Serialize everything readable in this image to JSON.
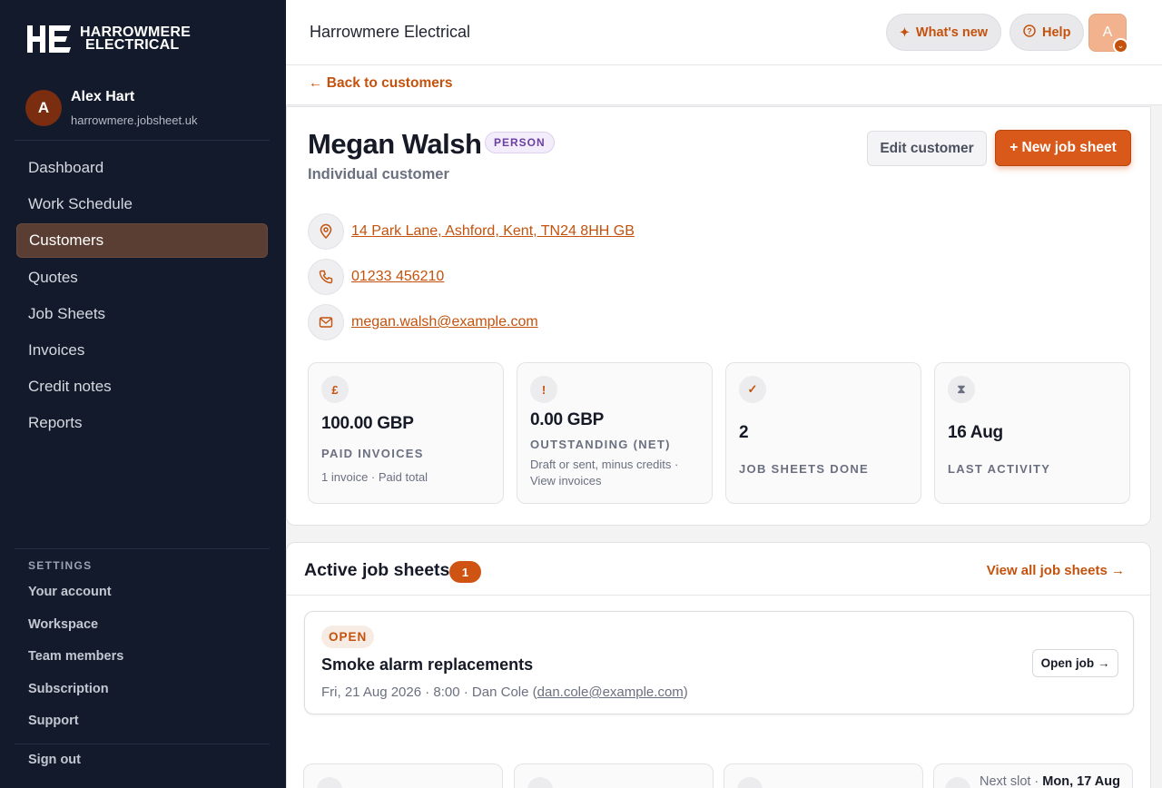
{
  "brand": {
    "name_line1": "HARROWMERE",
    "name_line2": "ELECTRICAL"
  },
  "user": {
    "initial": "A",
    "name": "Alex Hart",
    "domain": "harrowmere.jobsheet.uk"
  },
  "nav": [
    {
      "label": "Dashboard",
      "active": false
    },
    {
      "label": "Work Schedule",
      "active": false
    },
    {
      "label": "Customers",
      "active": true
    },
    {
      "label": "Quotes",
      "active": false
    },
    {
      "label": "Job Sheets",
      "active": false
    },
    {
      "label": "Invoices",
      "active": false
    },
    {
      "label": "Credit notes",
      "active": false
    },
    {
      "label": "Reports",
      "active": false
    }
  ],
  "settings": {
    "heading": "SETTINGS",
    "items": [
      "Your account",
      "Workspace",
      "Team members",
      "Subscription",
      "Support"
    ],
    "sign_out": "Sign out"
  },
  "topbar": {
    "title": "Harrowmere Electrical",
    "whats_new": "What's new",
    "help": "Help",
    "avatar_initial": "A"
  },
  "back_link": "← Back to customers",
  "customer": {
    "name": "Megan Walsh",
    "type_badge": "PERSON",
    "subtitle": "Individual customer",
    "edit_button": "Edit customer",
    "new_job_button": "+ New job sheet",
    "address": "14 Park Lane, Ashford, Kent, TN24 8HH GB",
    "phone": "01233 456210",
    "email": "megan.walsh@example.com"
  },
  "stats": [
    {
      "icon": "£",
      "icon_name": "pound-icon",
      "value": "100.00 GBP",
      "label": "PAID INVOICES",
      "note": "1 invoice · Paid total"
    },
    {
      "icon": "!",
      "icon_name": "alert-icon",
      "value": "0.00 GBP",
      "label": "OUTSTANDING (NET)",
      "note": "Draft or sent, minus credits · View invoices"
    },
    {
      "icon": "✓",
      "icon_name": "check-icon",
      "value": "2",
      "label": "JOB SHEETS DONE",
      "note": ""
    },
    {
      "icon": "⧗",
      "icon_name": "hourglass-icon",
      "value": "16 Aug",
      "label": "LAST ACTIVITY",
      "note": ""
    }
  ],
  "jobs": {
    "title": "Active job sheets",
    "count": "1",
    "view_all": "View all job sheets →",
    "items": [
      {
        "status": "OPEN",
        "title": "Smoke alarm replacements",
        "meta_prefix": "Fri, 21 Aug 2026 · 8:00 · Dan Cole (",
        "meta_email": "dan.cole@example.com",
        "meta_suffix": ")",
        "open_button": "Open job →"
      }
    ]
  },
  "next_slot": {
    "label": "Next slot · ",
    "value": "Mon, 17 Aug"
  },
  "colors": {
    "accent": "#d9591a",
    "sidebar": "#121a2b",
    "active_nav": "#5b3e33",
    "person_badge": "#6b3fa0"
  }
}
